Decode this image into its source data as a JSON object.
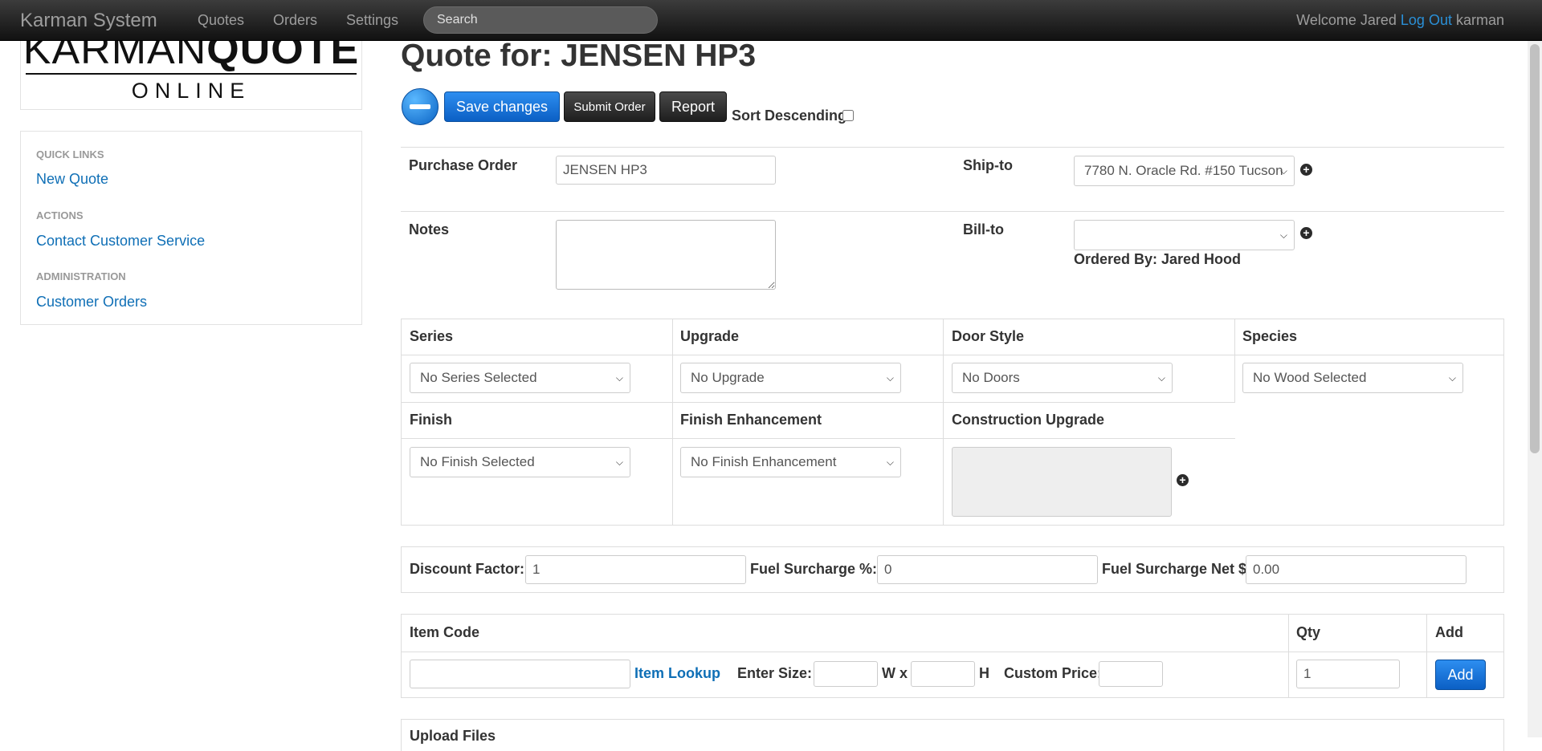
{
  "navbar": {
    "brand": "Karman System",
    "links": [
      "Quotes",
      "Orders",
      "Settings"
    ],
    "search_placeholder": "Search",
    "welcome": "Welcome Jared",
    "logout": "Log Out",
    "username": "karman"
  },
  "logo": {
    "part1": "KARMAN",
    "part2": "QUOTE",
    "sub": "ONLINE"
  },
  "sidebar": {
    "quick_links_header": "QUICK LINKS",
    "new_quote": "New Quote",
    "actions_header": "ACTIONS",
    "contact": "Contact Customer Service",
    "admin_header": "ADMINISTRATION",
    "customer_orders": "Customer Orders"
  },
  "page": {
    "title": "Quote for: JENSEN HP3"
  },
  "toolbar": {
    "save_label": "Save changes",
    "submit_label": "Submit Order",
    "report_label": "Report",
    "sort_label": "Sort Descending"
  },
  "form": {
    "po_label": "Purchase Order",
    "po_value": "JENSEN HP3",
    "shipto_label": "Ship-to",
    "shipto_value": "7780 N. Oracle Rd. #150 Tucson",
    "notes_label": "Notes",
    "notes_value": "",
    "billto_label": "Bill-to",
    "billto_value": "",
    "ordered_by": "Ordered By: Jared Hood"
  },
  "options": {
    "series_label": "Series",
    "series_value": "No Series Selected",
    "upgrade_label": "Upgrade",
    "upgrade_value": "No Upgrade",
    "door_label": "Door Style",
    "door_value": "No Doors",
    "species_label": "Species",
    "species_value": "No Wood Selected",
    "finish_label": "Finish",
    "finish_value": "No Finish Selected",
    "enh_label": "Finish Enhancement",
    "enh_value": "No Finish Enhancement",
    "construction_label": "Construction Upgrade"
  },
  "surcharge": {
    "discount_label": "Discount Factor:",
    "discount_value": "1",
    "fuel_pct_label": "Fuel Surcharge %:",
    "fuel_pct_value": "0",
    "fuel_net_label": "Fuel Surcharge Net $",
    "fuel_net_value": "0.00"
  },
  "items": {
    "code_header": "Item Code",
    "qty_header": "Qty",
    "add_header": "Add",
    "lookup_label": "Item Lookup",
    "size_label": "Enter Size:",
    "w_label": "W x",
    "h_label": "H",
    "price_label": "Custom Price:",
    "qty_value": "1",
    "add_button": "Add"
  },
  "upload": {
    "title": "Upload Files"
  }
}
